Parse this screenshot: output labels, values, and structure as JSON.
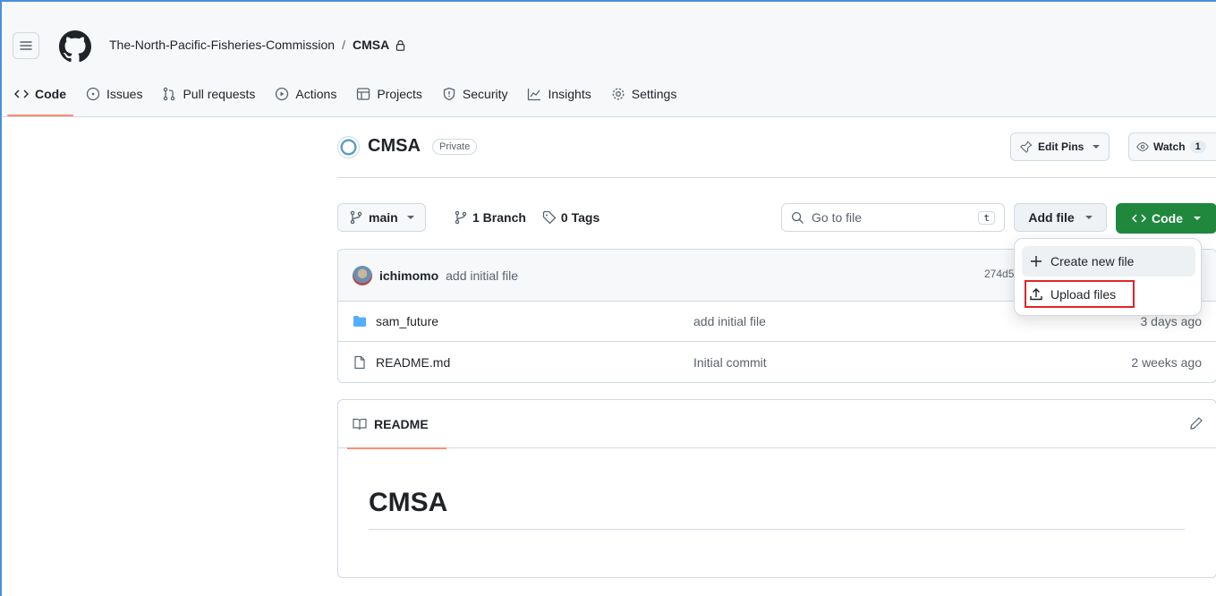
{
  "header": {
    "owner": "The-North-Pacific-Fisheries-Commission",
    "separator": "/",
    "repo": "CMSA",
    "tabs": [
      {
        "label": "Code",
        "icon": "code-icon",
        "active": true
      },
      {
        "label": "Issues",
        "icon": "issue-icon"
      },
      {
        "label": "Pull requests",
        "icon": "pull-request-icon"
      },
      {
        "label": "Actions",
        "icon": "play-icon"
      },
      {
        "label": "Projects",
        "icon": "table-icon"
      },
      {
        "label": "Security",
        "icon": "shield-icon"
      },
      {
        "label": "Insights",
        "icon": "graph-icon"
      },
      {
        "label": "Settings",
        "icon": "gear-icon"
      }
    ]
  },
  "repo_head": {
    "name": "CMSA",
    "visibility": "Private",
    "edit_pins_label": "Edit Pins",
    "watch_label": "Watch",
    "watch_count": "1"
  },
  "toolbar": {
    "branch": "main",
    "branch_count": "1 Branch",
    "tag_count": "0 Tags",
    "goto_placeholder": "Go to file",
    "goto_shortcut": "t",
    "add_file_label": "Add file",
    "code_label": "Code"
  },
  "latest_commit": {
    "author": "ichimomo",
    "message": "add initial file",
    "hash": "274d5"
  },
  "files": [
    {
      "name": "sam_future",
      "type": "folder",
      "message": "add initial file",
      "age": "3 days ago"
    },
    {
      "name": "README.md",
      "type": "file",
      "message": "Initial commit",
      "age": "2 weeks ago"
    }
  ],
  "readme": {
    "tab_label": "README",
    "heading": "CMSA"
  },
  "dropdown": {
    "items": [
      {
        "label": "Create new file",
        "icon": "plus-icon"
      },
      {
        "label": "Upload files",
        "icon": "upload-icon"
      }
    ]
  },
  "colors": {
    "accent_tab": "#fd8c73",
    "primary_button": "#1f883d",
    "highlight": "#e0242c",
    "frame": "#4a90d9"
  }
}
